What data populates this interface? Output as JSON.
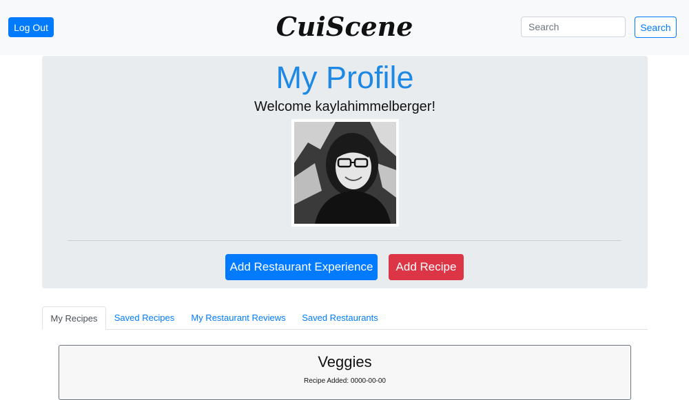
{
  "navbar": {
    "logout_label": "Log Out",
    "brand": "CuiScene",
    "search_placeholder": "Search",
    "search_label": "Search"
  },
  "profile": {
    "title": "My Profile",
    "welcome": "Welcome kaylahimmelberger!",
    "add_experience_label": "Add Restaurant Experience",
    "add_recipe_label": "Add Recipe"
  },
  "tabs": [
    {
      "label": "My Recipes",
      "active": true
    },
    {
      "label": "Saved Recipes",
      "active": false
    },
    {
      "label": "My Restaurant Reviews",
      "active": false
    },
    {
      "label": "Saved Restaurants",
      "active": false
    }
  ],
  "recipes": [
    {
      "title": "Veggies",
      "date_text": "Recipe Added: 0000-00-00"
    }
  ],
  "colors": {
    "primary": "#007bff",
    "danger": "#dc3545",
    "jumbotron": "#e9ecef",
    "title_blue": "#1e88e5"
  }
}
